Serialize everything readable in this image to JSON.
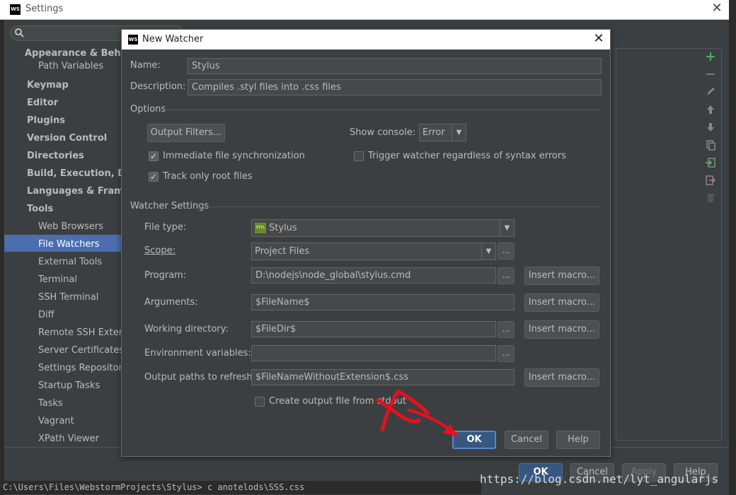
{
  "settings": {
    "app_icon": "WS",
    "title": "Settings",
    "close_glyph": "✕",
    "tree": [
      {
        "label": "Appearance & Behavior",
        "bold": true,
        "arrow": ""
      },
      {
        "label": "Path Variables",
        "bold": false,
        "arrow": ""
      },
      {
        "label": "Keymap",
        "bold": true,
        "arrow": ""
      },
      {
        "label": "Editor",
        "bold": true,
        "arrow": "▶"
      },
      {
        "label": "Plugins",
        "bold": true,
        "arrow": ""
      },
      {
        "label": "Version Control",
        "bold": true,
        "arrow": "▶"
      },
      {
        "label": "Directories",
        "bold": true,
        "arrow": ""
      },
      {
        "label": "Build, Execution, Deployment",
        "bold": true,
        "arrow": "▶"
      },
      {
        "label": "Languages & Frameworks",
        "bold": true,
        "arrow": "▶"
      },
      {
        "label": "Tools",
        "bold": true,
        "arrow": "▼"
      },
      {
        "label": "Web Browsers",
        "bold": false,
        "arrow": ""
      },
      {
        "label": "File Watchers",
        "bold": false,
        "arrow": "",
        "selected": true
      },
      {
        "label": "External Tools",
        "bold": false,
        "arrow": ""
      },
      {
        "label": "Terminal",
        "bold": false,
        "arrow": ""
      },
      {
        "label": "SSH Terminal",
        "bold": false,
        "arrow": ""
      },
      {
        "label": "Diff",
        "bold": false,
        "arrow": "▶"
      },
      {
        "label": "Remote SSH External Tools",
        "bold": false,
        "arrow": ""
      },
      {
        "label": "Server Certificates",
        "bold": false,
        "arrow": ""
      },
      {
        "label": "Settings Repository",
        "bold": false,
        "arrow": ""
      },
      {
        "label": "Startup Tasks",
        "bold": false,
        "arrow": ""
      },
      {
        "label": "Tasks",
        "bold": false,
        "arrow": "▶"
      },
      {
        "label": "Vagrant",
        "bold": false,
        "arrow": ""
      },
      {
        "label": "XPath Viewer",
        "bold": false,
        "arrow": ""
      }
    ],
    "side_icons": [
      "plus-icon",
      "minus-icon",
      "edit-icon",
      "move-up-icon",
      "move-down-icon",
      "copy-icon",
      "import-icon",
      "export-icon",
      "delete-icon"
    ],
    "buttons": {
      "ok": "OK",
      "cancel": "Cancel",
      "apply": "Apply",
      "help": "Help"
    },
    "console_text": "C:\\Users\\Files\\WebstormProjects\\Stylus> c anotelods\\SSS.css",
    "watermark": "https://blog.csdn.net/lyt_angularjs"
  },
  "dialog": {
    "app_icon": "WS",
    "title": "New Watcher",
    "close_glyph": "✕",
    "name_label": "Name:",
    "name_value": "Stylus",
    "description_label": "Description:",
    "description_value": "Compiles .styl files into .css files",
    "options_section": "Options",
    "output_filters_button": "Output Filters...",
    "show_console_label": "Show console:",
    "show_console_value": "Error",
    "immediate_sync_label": "Immediate file synchronization",
    "immediate_sync_checked": true,
    "trigger_watcher_label": "Trigger watcher regardless of syntax errors",
    "trigger_watcher_checked": false,
    "track_root_label": "Track only root files",
    "track_root_checked": true,
    "watcher_section": "Watcher Settings",
    "file_type_label": "File type:",
    "file_type_value": "Stylus",
    "file_type_icon": "STYL",
    "scope_label": "Scope:",
    "scope_value": "Project Files",
    "program_label": "Program:",
    "program_value": "D:\\nodejs\\node_global\\stylus.cmd",
    "arguments_label": "Arguments:",
    "arguments_value": "$FileName$",
    "working_dir_label": "Working directory:",
    "working_dir_value": "$FileDir$",
    "env_vars_label": "Environment variables:",
    "env_vars_value": "",
    "output_paths_label": "Output paths to refresh:",
    "output_paths_value": "$FileNameWithoutExtension$.css",
    "create_output_label": "Create output file from stdout",
    "create_output_checked": false,
    "insert_macro_label": "Insert macro...",
    "ellipsis_label": "...",
    "ok_label": "OK",
    "cancel_label": "Cancel",
    "help_label": "Help",
    "annotation_color": "#e8101b"
  }
}
